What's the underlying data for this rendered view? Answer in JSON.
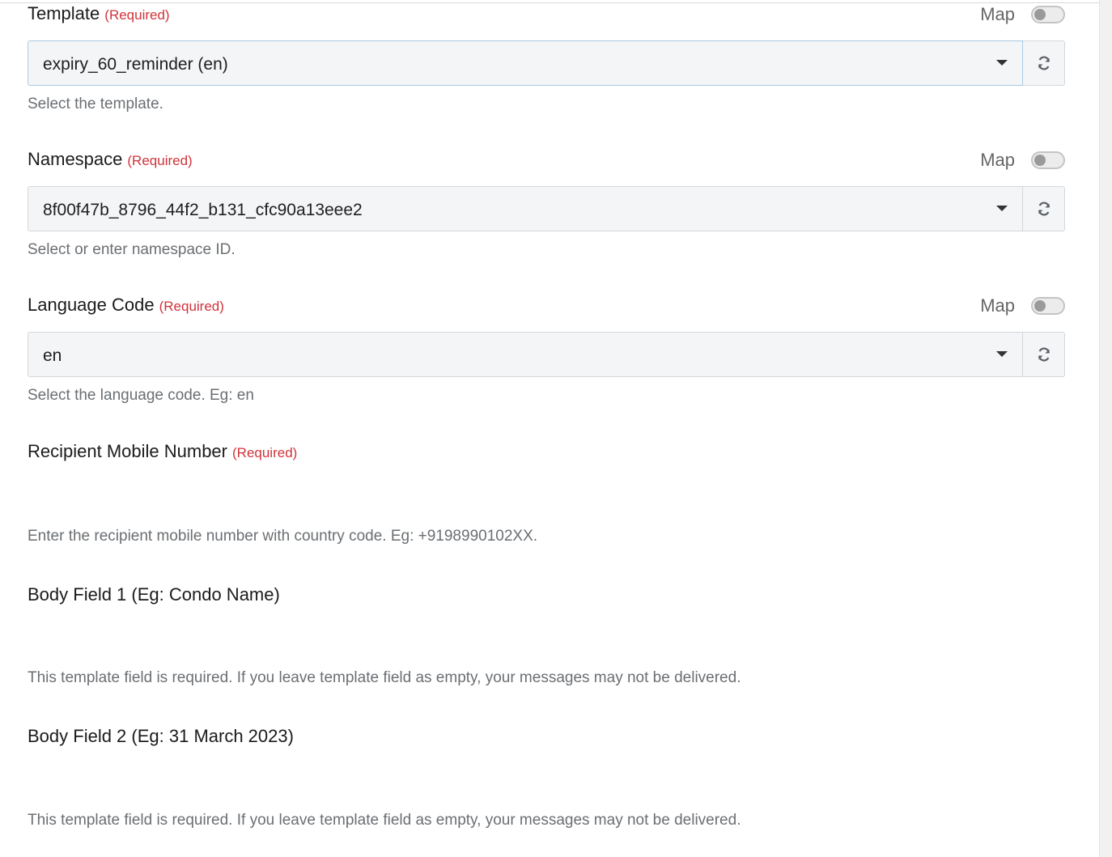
{
  "fields": [
    {
      "label": "Template",
      "required": "(Required)",
      "map_label": "Map",
      "value": "expiry_60_reminder (en)",
      "help": "Select the template."
    },
    {
      "label": "Namespace",
      "required": "(Required)",
      "map_label": "Map",
      "value": "8f00f47b_8796_44f2_b131_cfc90a13eee2",
      "help": "Select or enter namespace ID."
    },
    {
      "label": "Language Code",
      "required": "(Required)",
      "map_label": "Map",
      "value": "en",
      "help": "Select the language code. Eg: en"
    }
  ],
  "recipient": {
    "label": "Recipient Mobile Number",
    "required": "(Required)",
    "help": "Enter the recipient mobile number with country code. Eg: +9198990102XX."
  },
  "body_field_1": {
    "label": "Body Field 1 (Eg: Condo Name)",
    "help": "This template field is required. If you leave template field as empty, your messages may not be delivered."
  },
  "body_field_2": {
    "label": "Body Field 2 (Eg: 31 March 2023)",
    "help": "This template field is required. If you leave template field as empty, your messages may not be delivered."
  },
  "toggle_state": "off",
  "icons": {
    "dropdown": "caret-down-icon",
    "refresh": "refresh-icon"
  },
  "colors": {
    "required": "#d0333b",
    "help_text": "#6b6f73",
    "input_bg": "#f3f5f7"
  }
}
